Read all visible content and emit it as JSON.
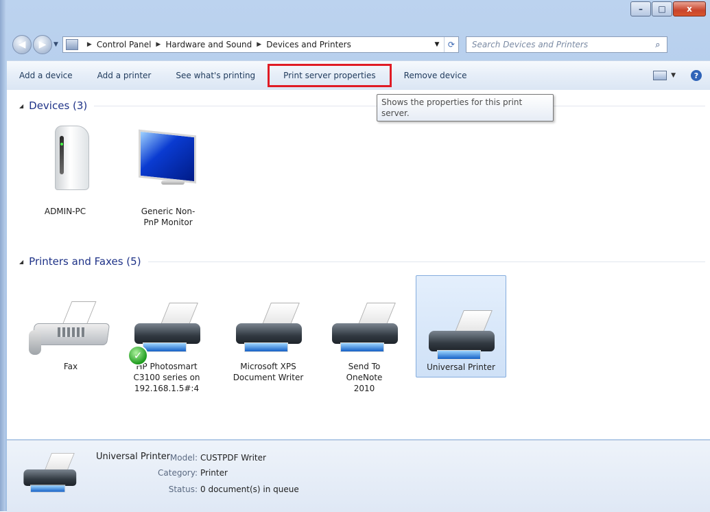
{
  "window": {
    "caption_buttons": {
      "minimize": "–",
      "maximize": "□",
      "close": "x"
    }
  },
  "navigation": {
    "back_glyph": "◀",
    "forward_glyph": "▶",
    "breadcrumb": [
      "Control Panel",
      "Hardware and Sound",
      "Devices and Printers"
    ],
    "search_placeholder": "Search Devices and Printers",
    "search_icon": "search-icon"
  },
  "toolbar": {
    "items": [
      "Add a device",
      "Add a printer",
      "See what's printing",
      "Print server properties",
      "Remove device"
    ],
    "highlighted_item": "Print server properties",
    "highlight_color": "#e01b24",
    "help_label": "?"
  },
  "tooltip": {
    "text": "Shows the properties for this print server."
  },
  "devices": {
    "header": "Devices (3)",
    "items": [
      {
        "label": "ADMIN-PC",
        "icon": "computer-icon"
      },
      {
        "label": "Generic Non-PnP Monitor",
        "icon": "monitor-icon"
      }
    ]
  },
  "printers": {
    "header": "Printers and Faxes (5)",
    "items": [
      {
        "label": "Fax",
        "icon": "fax-icon"
      },
      {
        "label": "HP Photosmart C3100 series on 192.168.1.5#:4",
        "icon": "printer-icon",
        "default": true
      },
      {
        "label": "Microsoft XPS Document Writer",
        "icon": "printer-icon"
      },
      {
        "label": "Send To OneNote 2010",
        "icon": "printer-icon"
      },
      {
        "label": "Universal Printer",
        "icon": "printer-icon",
        "selected": true
      }
    ]
  },
  "details": {
    "name": "Universal Printer",
    "model_key": "Model:",
    "model_value": "CUSTPDF Writer",
    "category_key": "Category:",
    "category_value": "Printer",
    "status_key": "Status:",
    "status_value": "0 document(s) in queue"
  },
  "colors": {
    "group_header": "#1e3287",
    "selection_bg": "#cfe1f7"
  }
}
